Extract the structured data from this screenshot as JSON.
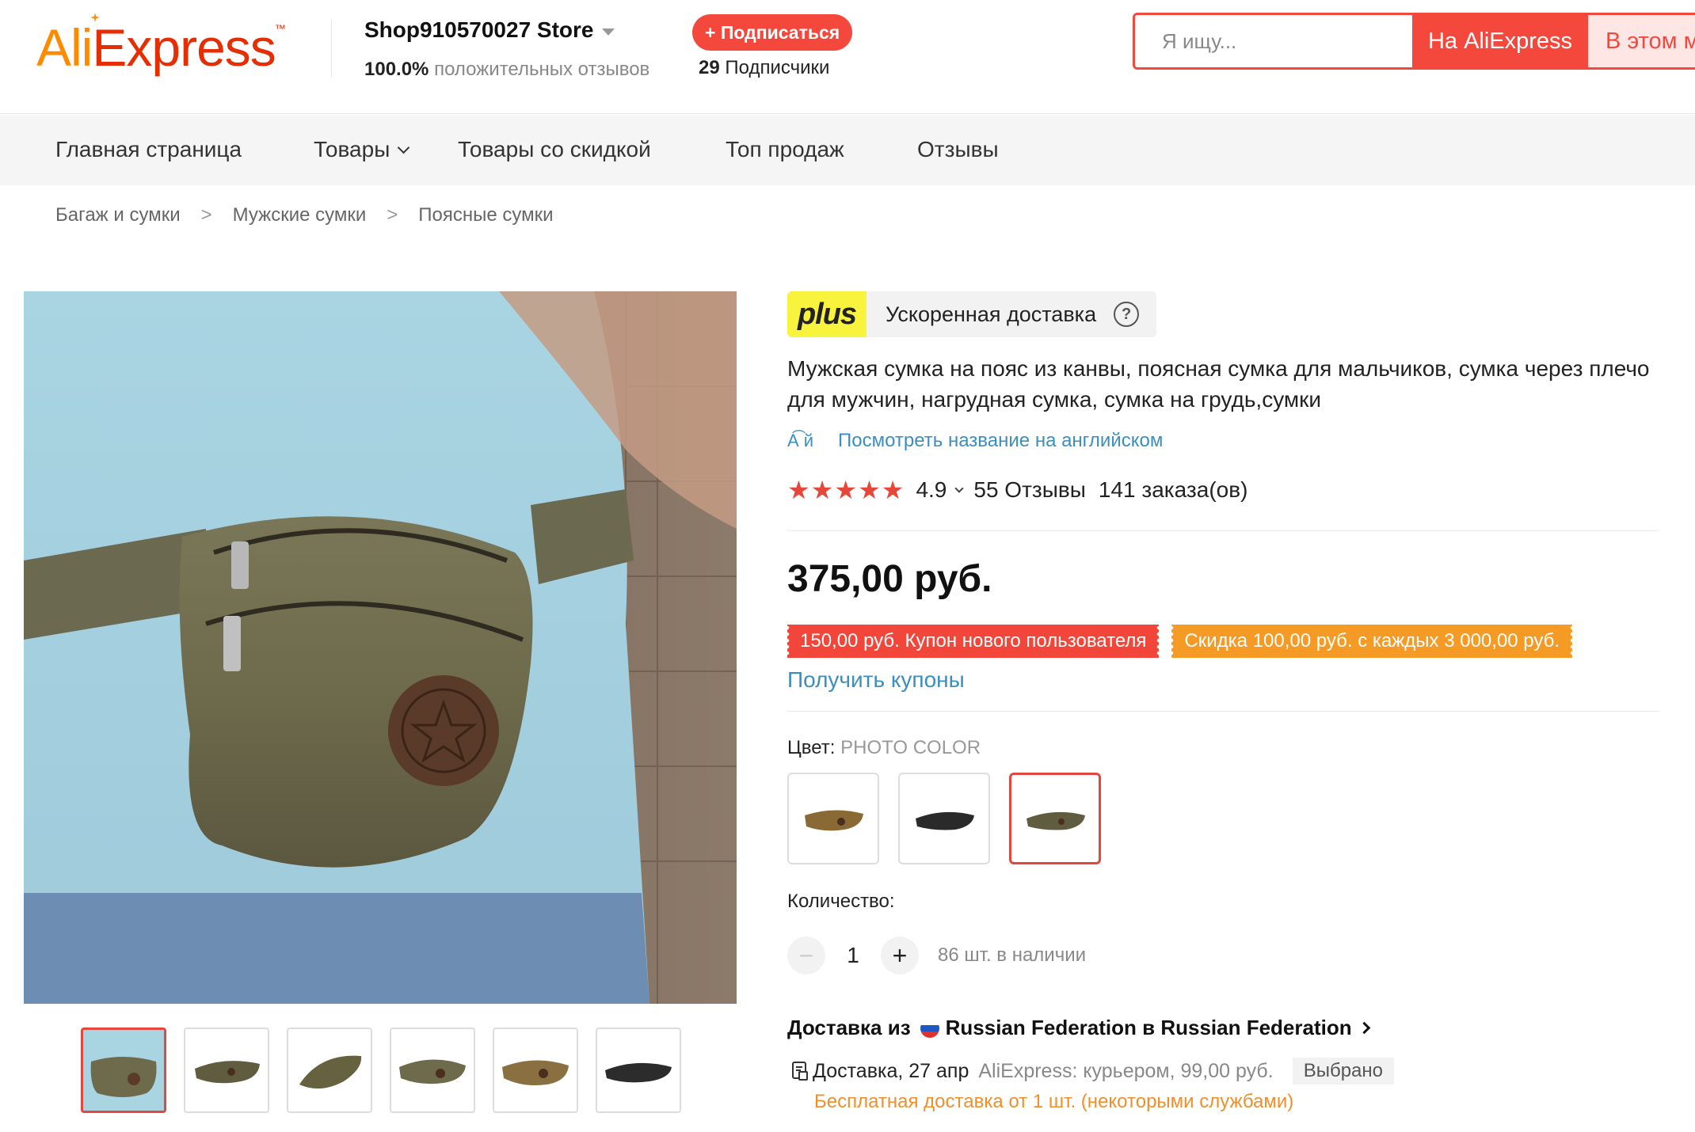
{
  "header": {
    "logo_ali": "Ali",
    "logo_express": "Express",
    "logo_tm": "™",
    "store_name": "Shop910570027 Store",
    "positive_percent": "100.0%",
    "positive_label": "положительных отзывов",
    "subscribe_label": "+ Подписаться",
    "followers_count": "29",
    "followers_label": "Подписчики",
    "search_placeholder": "Я ищу...",
    "search_ali_label": "На AliExpress",
    "search_store_label": "В этом м"
  },
  "nav": {
    "items": [
      {
        "label": "Главная страница"
      },
      {
        "label": "Товары"
      },
      {
        "label": "Товары со скидкой"
      },
      {
        "label": "Топ продаж"
      },
      {
        "label": "Отзывы"
      }
    ]
  },
  "breadcrumb": [
    "Багаж и сумки",
    "Мужские сумки",
    "Поясные сумки"
  ],
  "breadcrumb_sep": ">",
  "product": {
    "plus_logo": "plus",
    "plus_text": "Ускоренная доставка",
    "help_glyph": "?",
    "title": "Мужская сумка на пояс из канвы, поясная сумка для мальчиков, сумка через плечо для мужчин, нагрудная сумка, сумка на грудь,сумки",
    "translate_icon_text": "A͡ й",
    "translate_label": "Посмотреть название на английском",
    "stars": "★★★★★",
    "rating": "4.9",
    "reviews": "55 Отзывы",
    "orders": "141 заказа(ов)",
    "price": "375,00 руб.",
    "coupon_new_user": "150,00 руб. Купон нового пользователя",
    "coupon_discount": "Скидка 100,00 руб. с каждых 3 000,00 руб.",
    "get_coupons": "Получить купоны",
    "color_label": "Цвет:",
    "color_value": "PHOTO COLOR",
    "quantity_label": "Количество:",
    "quantity_minus": "−",
    "quantity_plus": "+",
    "quantity_value": "1",
    "stock": "86 шт. в наличии"
  },
  "shipping": {
    "title_prefix": "Доставка из",
    "title_route": "Russian Federation в Russian Federation",
    "delivery_date": "Доставка, 27 апр",
    "carrier": "AliExpress: курьером, 99,00 руб.",
    "chosen": "Выбрано",
    "free_shipping": "Бесплатная доставка от 1 шт. (некоторыми службами)"
  },
  "colors": {
    "accent": "#f5483d",
    "link": "#3b8ec0",
    "coupon_orange": "#f59b25",
    "plus_yellow": "#f8f33c",
    "logo_orange": "#ff8a00",
    "logo_red": "#e62e04"
  },
  "gallery": {
    "thumbnail_count": 6,
    "active_thumbnail": 1,
    "swatch_count": 3,
    "selected_swatch": 3
  }
}
